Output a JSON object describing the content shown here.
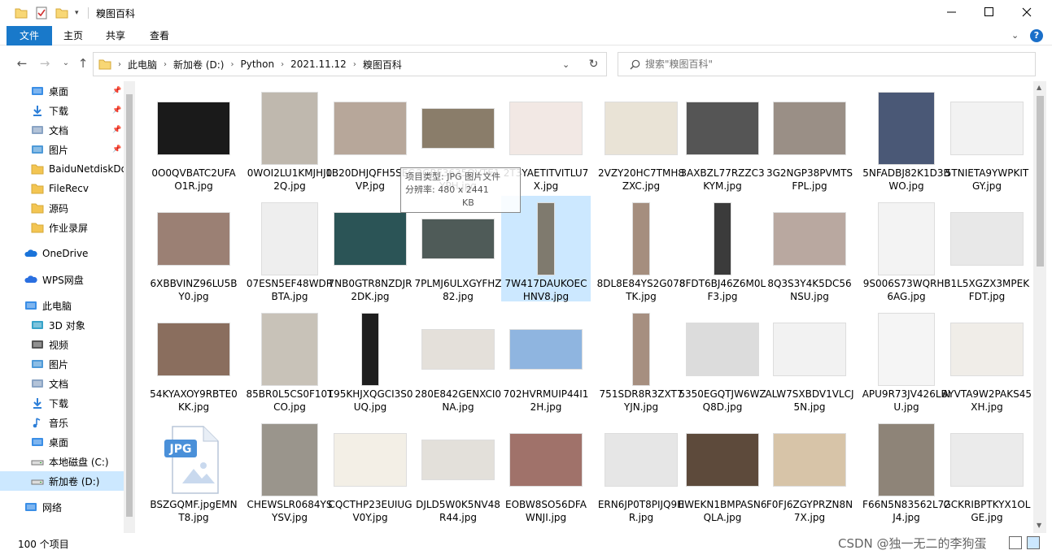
{
  "window": {
    "title": "糗图百科"
  },
  "ribbon": {
    "tabs": [
      "文件",
      "主页",
      "共享",
      "查看"
    ],
    "help_icon": "?"
  },
  "address": {
    "crumbs": [
      "此电脑",
      "新加卷 (D:)",
      "Python",
      "2021.11.12",
      "糗图百科"
    ]
  },
  "search": {
    "placeholder": "搜索\"糗图百科\""
  },
  "sidebar": {
    "items": [
      {
        "label": "桌面",
        "icon": "desktop-icon",
        "pinned": true
      },
      {
        "label": "下载",
        "icon": "download-icon",
        "pinned": true
      },
      {
        "label": "文档",
        "icon": "documents-icon",
        "pinned": true
      },
      {
        "label": "图片",
        "icon": "pictures-icon",
        "pinned": true
      },
      {
        "label": "BaiduNetdiskDo",
        "icon": "folder-icon",
        "pinned": false
      },
      {
        "label": "FileRecv",
        "icon": "folder-icon",
        "pinned": false
      },
      {
        "label": "源码",
        "icon": "folder-icon",
        "pinned": false
      },
      {
        "label": "作业录屏",
        "icon": "folder-icon",
        "pinned": false
      },
      {
        "label": "OneDrive",
        "icon": "onedrive-icon",
        "pinned": false
      },
      {
        "label": "WPS网盘",
        "icon": "wps-cloud-icon",
        "pinned": false
      },
      {
        "label": "此电脑",
        "icon": "this-pc-icon",
        "pinned": false
      },
      {
        "label": "3D 对象",
        "icon": "3d-objects-icon",
        "pinned": false
      },
      {
        "label": "视频",
        "icon": "videos-icon",
        "pinned": false
      },
      {
        "label": "图片",
        "icon": "pictures-icon",
        "pinned": false
      },
      {
        "label": "文档",
        "icon": "documents-icon",
        "pinned": false
      },
      {
        "label": "下载",
        "icon": "download-icon",
        "pinned": false
      },
      {
        "label": "音乐",
        "icon": "music-icon",
        "pinned": false
      },
      {
        "label": "桌面",
        "icon": "desktop-icon",
        "pinned": false
      },
      {
        "label": "本地磁盘 (C:)",
        "icon": "drive-icon",
        "pinned": false
      },
      {
        "label": "新加卷 (D:)",
        "icon": "drive-icon",
        "pinned": false,
        "selected": true
      },
      {
        "label": "网络",
        "icon": "network-icon",
        "pinned": false
      }
    ]
  },
  "files": [
    {
      "name": "0O0QVBATC2UFAO1R.jpg",
      "color": "#1a1a1a"
    },
    {
      "name": "0WOI2LU1KMJHJ02Q.jpg",
      "color": "#bfb8ae"
    },
    {
      "name": "1B20DHJQFH5SECVP.jpg",
      "color": "#b7a79a"
    },
    {
      "name": "2GRF3635QVTE1YPH.jpg",
      "color": "#8a7d6a"
    },
    {
      "name": "2T3YAETITVITLU7X.jpg",
      "color": "#f2e8e4"
    },
    {
      "name": "2VZY20HC7TMH8ZXC.jpg",
      "color": "#e9e3d6"
    },
    {
      "name": "3AXBZL77RZZC3KYM.jpg",
      "color": "#555555"
    },
    {
      "name": "3G2NGP38PVMTSFPL.jpg",
      "color": "#9a8f86"
    },
    {
      "name": "5NFADBJ82K1D3BWO.jpg",
      "color": "#4a5876"
    },
    {
      "name": "5TNIETA9YWPKITGY.jpg",
      "color": "#f2f2f2"
    },
    {
      "name": "6XBBVINZ96LU5BY0.jpg",
      "color": "#9b8074"
    },
    {
      "name": "07ESN5EF48WDRBTA.jpg",
      "color": "#eeeeee"
    },
    {
      "name": "7NB0GTR8NZDJR2DK.jpg",
      "color": "#2b5456"
    },
    {
      "name": "7PLMJ6ULXGYFHZ82.jpg",
      "color": "#4f5b58"
    },
    {
      "name": "7W417DAUKOECHNV8.jpg",
      "color": "#7f7a6e",
      "selected": true
    },
    {
      "name": "8DL8E84YS2G078TK.jpg",
      "color": "#a58e7e"
    },
    {
      "name": "8FDT6BJ46Z6M0LF3.jpg",
      "color": "#3b3b3b"
    },
    {
      "name": "8Q3S3Y4K5DC56NSU.jpg",
      "color": "#b9a8a0"
    },
    {
      "name": "9S006S73WQRHF6AG.jpg",
      "color": "#f3f3f3"
    },
    {
      "name": "31L5XGZX3MPEKFDT.jpg",
      "color": "#e8e8e8"
    },
    {
      "name": "54KYAXOY9RBTE0KK.jpg",
      "color": "#8a6e5e"
    },
    {
      "name": "85BR0L5CS0F10TCO.jpg",
      "color": "#c8c2b8"
    },
    {
      "name": "195KHJXQGCI3S0UQ.jpg",
      "color": "#1e1e1e"
    },
    {
      "name": "280E842GENXCI0NA.jpg",
      "color": "#e4e0da"
    },
    {
      "name": "702HVRMUIP44I12H.jpg",
      "color": "#8fb5e0"
    },
    {
      "name": "751SDR8R3ZXT7YJN.jpg",
      "color": "#a68f80"
    },
    {
      "name": "5350EGQTJW6WZQ8D.jpg",
      "color": "#dcdcdc"
    },
    {
      "name": "ALW7SXBDV1VLCJ5N.jpg",
      "color": "#f2f2f2"
    },
    {
      "name": "APU9R73JV426LBIU.jpg",
      "color": "#f5f5f5"
    },
    {
      "name": "AYVTA9W2PAKS45XH.jpg",
      "color": "#f0ede8"
    },
    {
      "name": "BSZGQMF.jpgEMNT8.jpg",
      "color": "#ffffff",
      "jpg_icon": true
    },
    {
      "name": "CHEWSLR0684YSYSV.jpg",
      "color": "#9a958c"
    },
    {
      "name": "CQCTHP23EUIUGV0Y.jpg",
      "color": "#f3efe6"
    },
    {
      "name": "DJLD5W0K5NV48R44.jpg",
      "color": "#e3e0da"
    },
    {
      "name": "EOBW8SO56DFAWNJI.jpg",
      "color": "#a0726a"
    },
    {
      "name": "ERN6JP0T8PIJQ9HR.jpg",
      "color": "#e6e6e6"
    },
    {
      "name": "EWEKN1BMPASN6QLA.jpg",
      "color": "#5d4a3b"
    },
    {
      "name": "F0FJ6ZGYPRZN8N7X.jpg",
      "color": "#d7c4a8"
    },
    {
      "name": "F66N5N83562L72J4.jpg",
      "color": "#8e8478"
    },
    {
      "name": "GCKRIBPTKYX1OLGE.jpg",
      "color": "#ebebeb"
    }
  ],
  "tooltip": {
    "line1": "项目类型: JPG 图片文件",
    "line2": "分辨率: 480 x 2441",
    "line3": "KB"
  },
  "status": {
    "count": "100 个项目",
    "watermark": "CSDN @独一无二的李狗蛋"
  }
}
